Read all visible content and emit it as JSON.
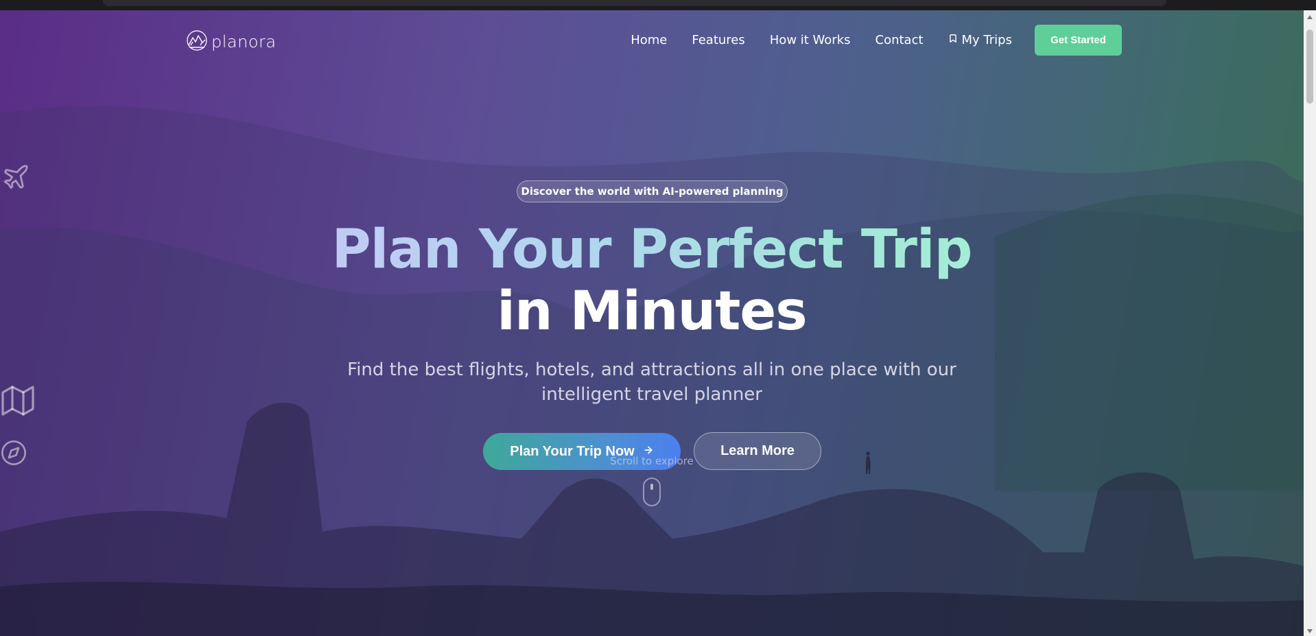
{
  "nav": {
    "logo_text": "planora",
    "links": [
      {
        "label": "Home"
      },
      {
        "label": "Features"
      },
      {
        "label": "How it Works"
      },
      {
        "label": "Contact"
      },
      {
        "label": "My Trips",
        "icon": "bookmark-icon"
      }
    ],
    "cta_label": "Get Started"
  },
  "side_icons": [
    "plane-icon",
    "map-icon",
    "compass-icon"
  ],
  "hero": {
    "badge": "Discover the world with AI-powered planning",
    "title_line1": "Plan Your Perfect Trip",
    "title_line2": "in Minutes",
    "subtitle": "Find the best flights, hotels, and attractions all in one place with our intelligent travel planner",
    "primary_button": "Plan Your Trip Now",
    "primary_button_icon": "arrow-right-icon",
    "secondary_button": "Learn More",
    "scroll_hint": "Scroll to explore"
  },
  "colors": {
    "accent_green": "#5fcf9a",
    "gradient_start": "#3fa89a",
    "gradient_end": "#4b7ff0"
  }
}
